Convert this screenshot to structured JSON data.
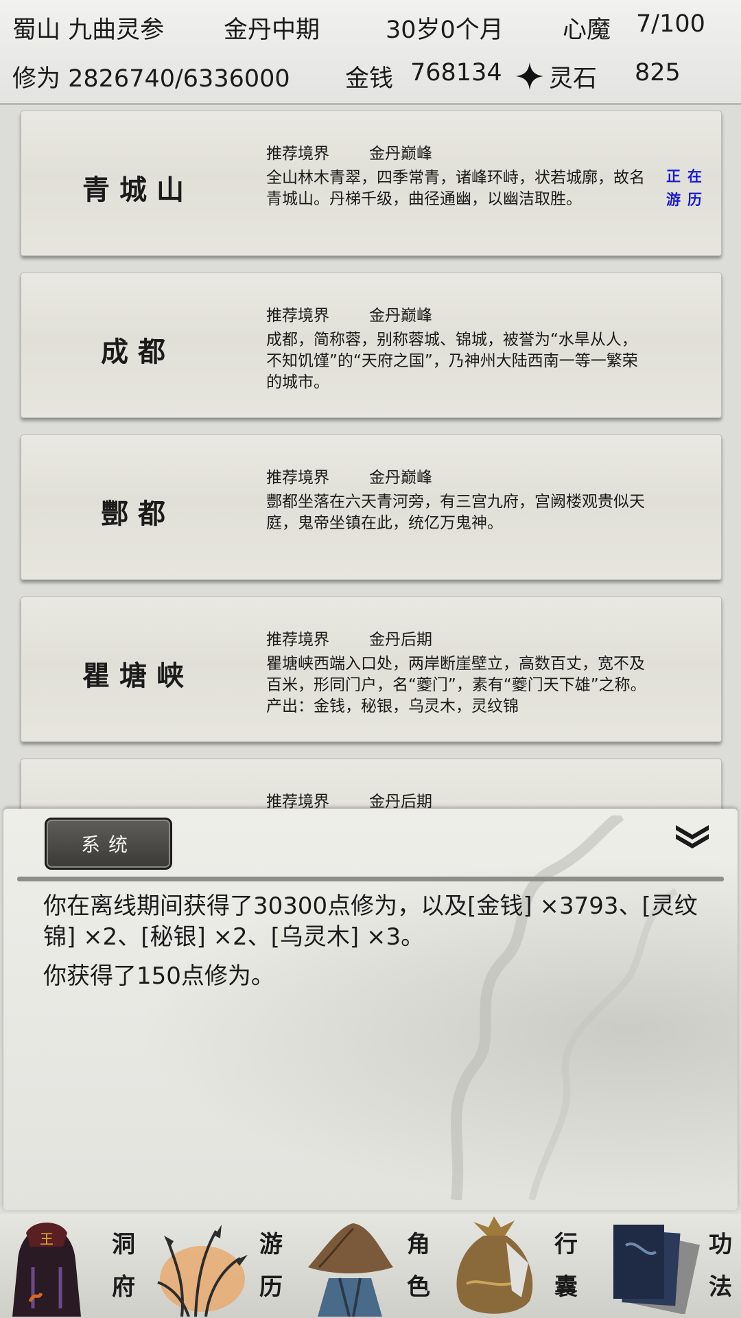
{
  "status": {
    "location": "蜀山 九曲灵参",
    "realm": "金丹中期",
    "age": "30岁0个月",
    "heart_demon_label": "心魔",
    "heart_demon_value": "7/100",
    "cultivation": "修为 2826740/6336000",
    "money_label": "金钱",
    "money_value": "768134",
    "spirit_stone_icon": "four-point-star-icon",
    "spirit_stone_label": "灵石",
    "spirit_stone_value": "825"
  },
  "locations": [
    {
      "name": "青城山",
      "realm_label": "推荐境界",
      "realm": "金丹巅峰",
      "desc": "全山林木青翠，四季常青，诸峰环峙，状若城廓，故名青城山。丹梯千级，曲径通幽，以幽洁取胜。",
      "status_line1": "正在",
      "status_line2": "游历"
    },
    {
      "name": "成都",
      "realm_label": "推荐境界",
      "realm": "金丹巅峰",
      "desc": "成都，简称蓉，别称蓉城、锦城，被誉为“水旱从人，不知饥馑”的“天府之国”，乃神州大陆西南一等一繁荣的城市。"
    },
    {
      "name": "酆都",
      "realm_label": "推荐境界",
      "realm": "金丹巅峰",
      "desc": "酆都坐落在六天青河旁，有三宫九府，宫阙楼观贵似天庭，鬼帝坐镇在此，统亿万鬼神。"
    },
    {
      "name": "瞿塘峡",
      "realm_label": "推荐境界",
      "realm": "金丹后期",
      "desc": "瞿塘峡西端入口处，两岸断崖壁立，高数百丈，宽不及百米，形同门户，名“夔门”，素有“夔门天下雄”之称。产出：金钱，秘银，乌灵木，灵纹锦"
    },
    {
      "realm_label": "推荐境界",
      "realm": "金丹后期"
    }
  ],
  "panel": {
    "tab_label": "系统",
    "collapse_icon": "double-chevron-down-icon",
    "messages": [
      "你在离线期间获得了30300点修为，以及[金钱] ×3793、[灵纹锦] ×2、[秘银] ×2、[乌灵木] ×3。",
      "你获得了150点修为。"
    ]
  },
  "nav": [
    {
      "c1": "洞",
      "c2": "府",
      "icon": "cave-lord-icon"
    },
    {
      "c1": "游",
      "c2": "历",
      "icon": "travel-reeds-icon"
    },
    {
      "c1": "角",
      "c2": "色",
      "icon": "straw-hat-icon"
    },
    {
      "c1": "行",
      "c2": "囊",
      "icon": "pouch-icon"
    },
    {
      "c1": "功",
      "c2": "法",
      "icon": "books-icon"
    }
  ]
}
